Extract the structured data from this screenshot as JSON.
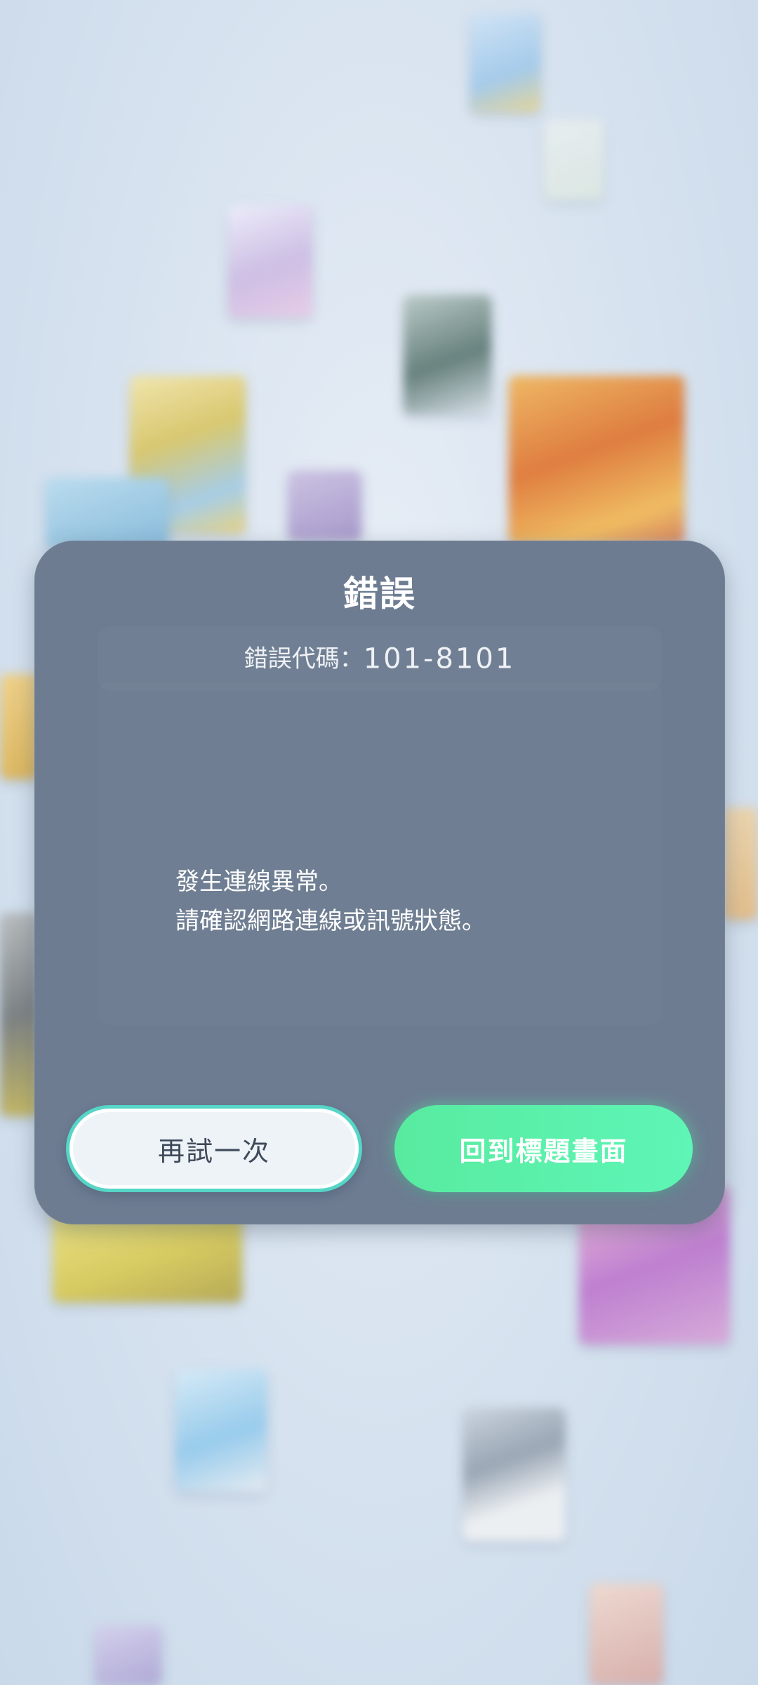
{
  "dialog": {
    "title": "錯誤",
    "error_code_label": "錯誤代碼：",
    "error_code_value": "101-8101",
    "message_lines": [
      "發生連線異常。",
      "請確認網路連線或訊號狀態。"
    ]
  },
  "buttons": {
    "retry_label": "再試一次",
    "back_to_title_label": "回到標題畫面"
  },
  "colors": {
    "dialog_bg": "#6d7c91",
    "retry_bg": "#eef3f8",
    "retry_border": "#55d6c6",
    "title_button_bg": "#5ef5b6"
  }
}
